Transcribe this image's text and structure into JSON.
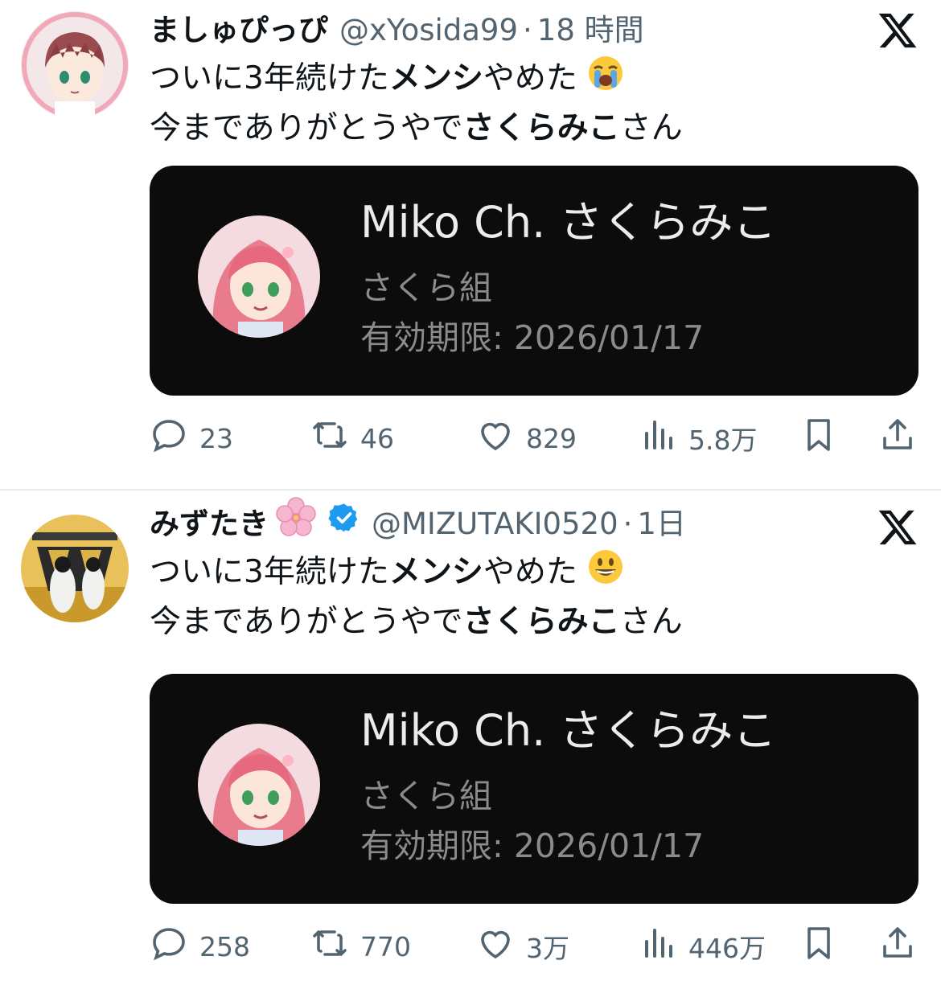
{
  "tweets": [
    {
      "name": "ましゅぴっぴ",
      "handle": "@xYosida99",
      "separator": "·",
      "time": "18 時間",
      "verified": false,
      "line1_a": "ついに3年続けた",
      "line1_bold": "メンシ",
      "line1_b": "やめた",
      "line1_emoji": "loudly-crying-face",
      "line2_a": "今までありがとうやで",
      "line2_bold": "さくらみこ",
      "line2_b": "さん",
      "card": {
        "title": "Miko Ch. さくらみこ",
        "tier": "さくら組",
        "expiry": "有効期限: 2026/01/17"
      },
      "actions": {
        "replies": "23",
        "retweets": "46",
        "likes": "829",
        "views": "5.8万"
      }
    },
    {
      "name": "みずたき",
      "name_emoji": "cherry-blossom",
      "handle": "@MIZUTAKI0520",
      "separator": "·",
      "time": "1日",
      "verified": true,
      "line1_a": "ついに3年続けた",
      "line1_bold": "メンシ",
      "line1_b": "やめた",
      "line1_emoji": "grinning-face",
      "line2_a": "今までありがとうやで",
      "line2_bold": "さくらみこ",
      "line2_b": "さん",
      "card": {
        "title": "Miko Ch. さくらみこ",
        "tier": "さくら組",
        "expiry": "有効期限: 2026/01/17"
      },
      "actions": {
        "replies": "258",
        "retweets": "770",
        "likes": "3万",
        "views": "446万"
      }
    }
  ],
  "colors": {
    "text": "#0f1419",
    "secondary": "#536471",
    "card_bg": "#0c0c0c",
    "card_title": "#ececec",
    "card_sub": "#8b8b8b",
    "verified": "#1d9bf0"
  }
}
